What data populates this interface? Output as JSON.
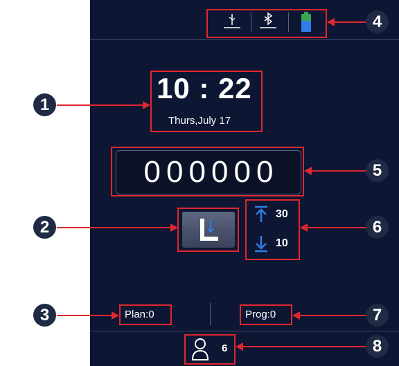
{
  "status_bar": {
    "usb_icon": "usb-icon",
    "bluetooth_icon": "bluetooth-icon",
    "battery_icon": "battery-icon"
  },
  "clock": {
    "time": "10 : 22",
    "date": "Thurs,July 17"
  },
  "counter": {
    "digits": [
      "0",
      "0",
      "0",
      "0",
      "0",
      "0"
    ]
  },
  "needle_settings": {
    "up_value": "30",
    "down_value": "10"
  },
  "footer": {
    "plan": "Plan:0",
    "prog": "Prog:0",
    "user_count": "6"
  },
  "callouts": [
    "1",
    "2",
    "3",
    "4",
    "5",
    "6",
    "7",
    "8"
  ],
  "colors": {
    "screen_bg": "#0d1633",
    "highlight": "#e0272e",
    "accent_blue": "#2f7ee8",
    "battery_green": "#3aa655"
  }
}
